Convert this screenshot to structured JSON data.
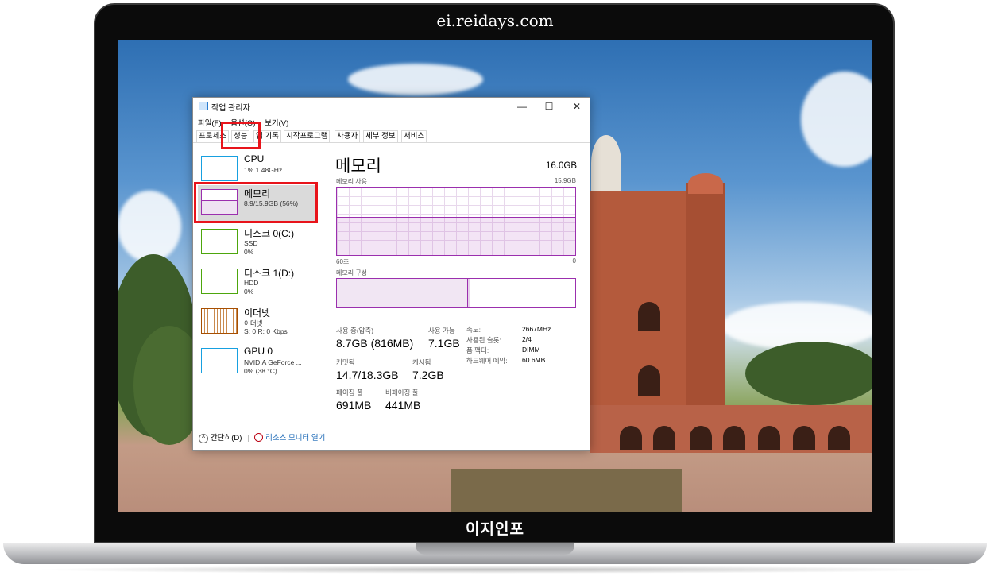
{
  "site_watermark": "ei.reidays.com",
  "brand_label": "이지인포",
  "window": {
    "title": "작업 관리자",
    "controls": {
      "minimize": "—",
      "maximize": "☐",
      "close": "✕"
    },
    "menu": [
      "파일(F)",
      "옵션(O)",
      "보기(V)"
    ],
    "tabs": [
      "프로세스",
      "성능",
      "앱 기록",
      "시작프로그램",
      "사용자",
      "세부 정보",
      "서비스"
    ],
    "active_tab": "성능"
  },
  "sidebar": {
    "items": [
      {
        "title": "CPU",
        "line1": "1% 1.48GHz",
        "line2": "",
        "color": "#17a0e0"
      },
      {
        "title": "메모리",
        "line1": "8.9/15.9GB (56%)",
        "line2": "",
        "color": "#9b2fae",
        "selected": true
      },
      {
        "title": "디스크 0(C:)",
        "line1": "SSD",
        "line2": "0%",
        "color": "#4da60c"
      },
      {
        "title": "디스크 1(D:)",
        "line1": "HDD",
        "line2": "0%",
        "color": "#4da60c"
      },
      {
        "title": "이더넷",
        "line1": "이더넷",
        "line2": "S: 0 R: 0 Kbps",
        "color": "#a74f01"
      },
      {
        "title": "GPU 0",
        "line1": "NVIDIA GeForce ...",
        "line2": "0% (38 °C)",
        "color": "#17a0e0"
      }
    ]
  },
  "memory": {
    "title": "메모리",
    "total": "16.0GB",
    "usage_label": "메모리 사용",
    "usage_max": "15.9GB",
    "x_left": "60초",
    "x_right": "0",
    "usage_fraction": 0.56,
    "composition_label": "메모리 구성",
    "composition_used_fraction": 0.55,
    "stats": {
      "in_use_label": "사용 중(압축)",
      "in_use": "8.7GB (816MB)",
      "available_label": "사용 가능",
      "available": "7.1GB",
      "committed_label": "커밋됨",
      "committed": "14.7/18.3GB",
      "cached_label": "캐시됨",
      "cached": "7.2GB",
      "paged_label": "페이징 풀",
      "paged": "691MB",
      "nonpaged_label": "비페이징 풀",
      "nonpaged": "441MB"
    },
    "details": [
      {
        "k": "속도:",
        "v": "2667MHz"
      },
      {
        "k": "사용된 슬롯:",
        "v": "2/4"
      },
      {
        "k": "폼 팩터:",
        "v": "DIMM"
      },
      {
        "k": "하드웨어 예약:",
        "v": "60.6MB"
      }
    ]
  },
  "footer": {
    "simple": "간단히(D)",
    "resource": "리소스 모니터 열기"
  },
  "highlight_color": "#e8141b"
}
